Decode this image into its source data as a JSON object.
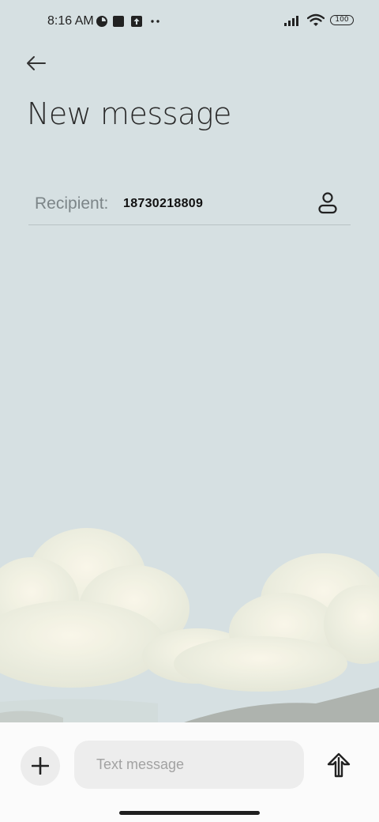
{
  "status_bar": {
    "time": "8:16 AM",
    "battery": "100",
    "left_icons": [
      "data-saver-icon",
      "square-notification-icon",
      "upload-notification-icon",
      "more-dots-icon"
    ],
    "right_icons": [
      "signal-icon",
      "wifi-icon",
      "battery-icon"
    ]
  },
  "header": {
    "back_icon": "arrow-left-icon",
    "title": "New message"
  },
  "recipient": {
    "label": "Recipient:",
    "value": "18730218809",
    "contact_icon": "person-icon"
  },
  "composer": {
    "add_icon": "plus-icon",
    "placeholder": "Text message",
    "value": "",
    "send_icon": "send-arrow-up-icon"
  },
  "colors": {
    "background": "#d6e0e2",
    "bottom_bar": "#fbfbfb",
    "input_bg": "#ededed",
    "label_gray": "#7c8588"
  }
}
